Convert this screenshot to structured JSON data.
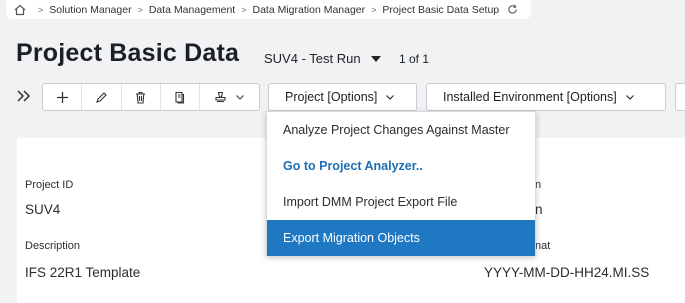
{
  "breadcrumb": {
    "items": [
      "Solution Manager",
      "Data Management",
      "Data Migration Manager",
      "Project Basic Data Setup"
    ]
  },
  "header": {
    "title": "Project Basic Data",
    "record": "SUV4 - Test Run",
    "record_count": "1 of 1"
  },
  "toolbar": {
    "project_options": "Project [Options]",
    "environment_options": "Installed Environment [Options]"
  },
  "form": {
    "project_id_label": "Project ID",
    "project_id_value": "SUV4",
    "description_label": "Description",
    "description_value": "IFS 22R1 Template",
    "right_label_1": "n",
    "right_value_1": "n",
    "right_label_2": "nat",
    "right_value_2": "YYYY-MM-DD-HH24.MI.SS"
  },
  "menu": {
    "items": [
      "Analyze Project Changes Against Master",
      "Go to Project Analyzer..",
      "Import DMM Project Export File",
      "Export Migration Objects"
    ]
  },
  "colors": {
    "accent": "#1e78c2",
    "link": "#1e6fb3",
    "background": "#f1f2f3"
  }
}
